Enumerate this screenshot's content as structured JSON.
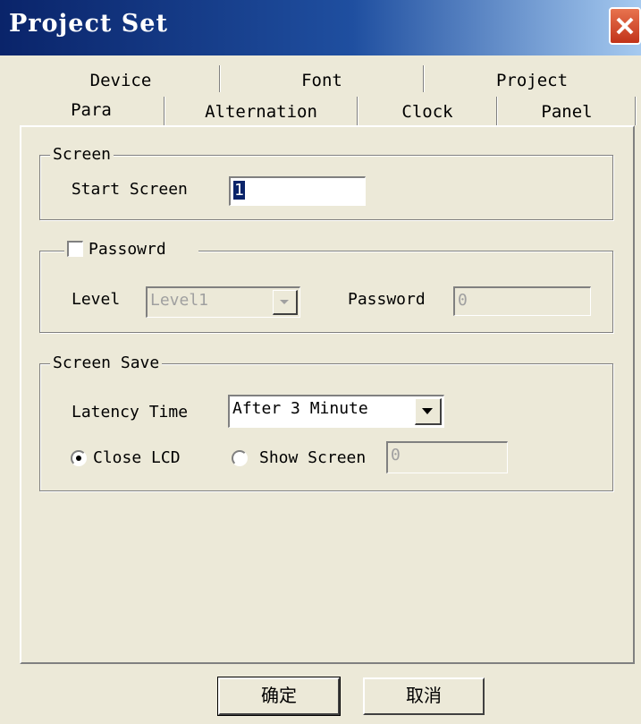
{
  "window": {
    "title": "Project Set"
  },
  "tabs": {
    "row1": [
      "Device",
      "Font",
      "Project"
    ],
    "row2": [
      "Para",
      "Alternation",
      "Clock",
      "Panel"
    ],
    "active": "Para"
  },
  "screen_group": {
    "title": "Screen",
    "start_screen_label": "Start Screen",
    "start_screen_value": "1"
  },
  "password_group": {
    "checkbox_label": "Passowrd",
    "checked": false,
    "level_label": "Level",
    "level_value": "Level1",
    "password_label": "Password",
    "password_value": "0"
  },
  "screen_save_group": {
    "title": "Screen Save",
    "latency_label": "Latency Time",
    "latency_value": "After 3 Minute",
    "close_lcd_label": "Close LCD",
    "show_screen_label": "Show Screen",
    "show_screen_value": "0",
    "selected_option": "Close LCD"
  },
  "buttons": {
    "ok": "确定",
    "cancel": "取消"
  },
  "icons": {
    "close": "close-icon",
    "dropdown": "chevron-down-icon"
  },
  "colors": {
    "titlebar": "#0A246A",
    "close_button": "#D6462A",
    "dialog_bg": "#ECE9D8"
  }
}
